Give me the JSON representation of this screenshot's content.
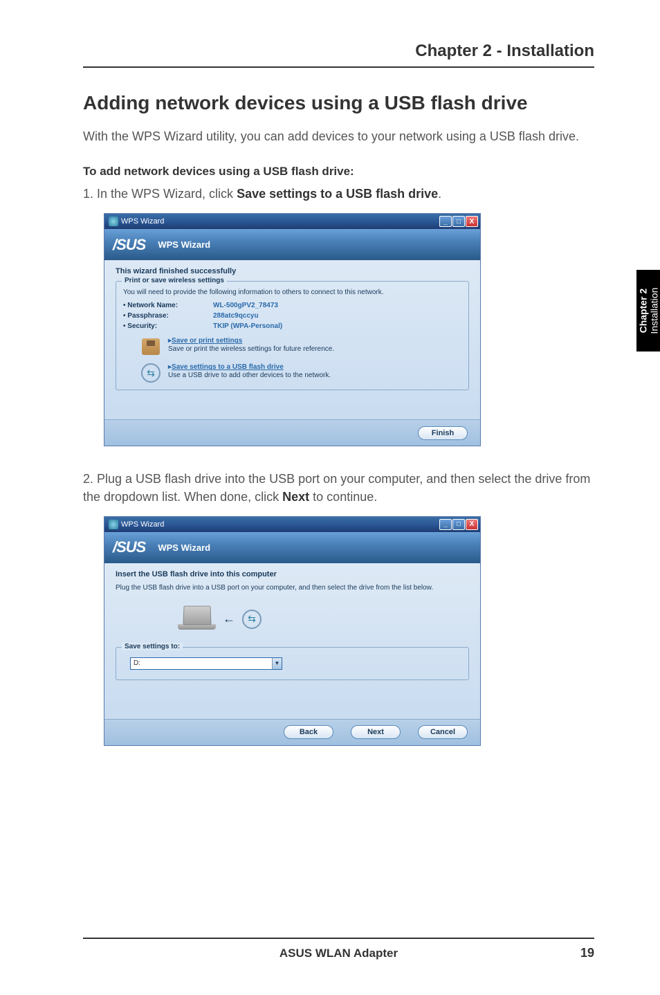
{
  "chapter_header": "Chapter 2 - Installation",
  "main_heading": "Adding network devices using a USB flash drive",
  "intro_text": "With the WPS Wizard utility, you can add devices to your network using a USB flash drive.",
  "sub_heading": "To add network devices using a USB flash drive:",
  "step1_prefix": "1.   In the WPS Wizard, click ",
  "step1_bold": "Save settings to a USB flash drive",
  "step1_suffix": ".",
  "step2_prefix": "2.   Plug a USB flash drive into the USB port on your computer, and then select the drive from the dropdown list. When done, click ",
  "step2_bold": "Next",
  "step2_suffix": " to continue.",
  "side_tab": {
    "line1": "Chapter 2",
    "line2": "Installation"
  },
  "footer": {
    "product": "ASUS WLAN Adapter",
    "page": "19"
  },
  "shot1": {
    "window_title": "WPS Wizard",
    "brand": "/SUS",
    "wizard_title": "WPS Wizard",
    "status": "This wizard finished successfully",
    "fieldset_legend": "Print or save wireless settings",
    "fieldset_desc": "You will need to provide the following information to others to connect to this network.",
    "rows": [
      {
        "label": "• Network Name:",
        "value": "WL-500gPV2_78473"
      },
      {
        "label": "• Passphrase:",
        "value": "288atc9qccyu"
      },
      {
        "label": "• Security:",
        "value": "TKIP (WPA-Personal)"
      }
    ],
    "action1_link": "Save or print settings",
    "action1_desc": "Save or print the wireless settings for future reference.",
    "action2_link": "Save settings to a USB flash drive",
    "action2_desc": "Use a USB drive to add other devices to the network.",
    "finish_btn": "Finish"
  },
  "shot2": {
    "window_title": "WPS Wizard",
    "brand": "/SUS",
    "wizard_title": "WPS Wizard",
    "heading": "Insert the USB flash drive into this computer",
    "desc": "Plug the USB flash drive into a USB port on your computer, and then select the drive from the list below.",
    "save_legend": "Save settings to:",
    "drive_value": "D:",
    "back_btn": "Back",
    "next_btn": "Next",
    "cancel_btn": "Cancel"
  }
}
